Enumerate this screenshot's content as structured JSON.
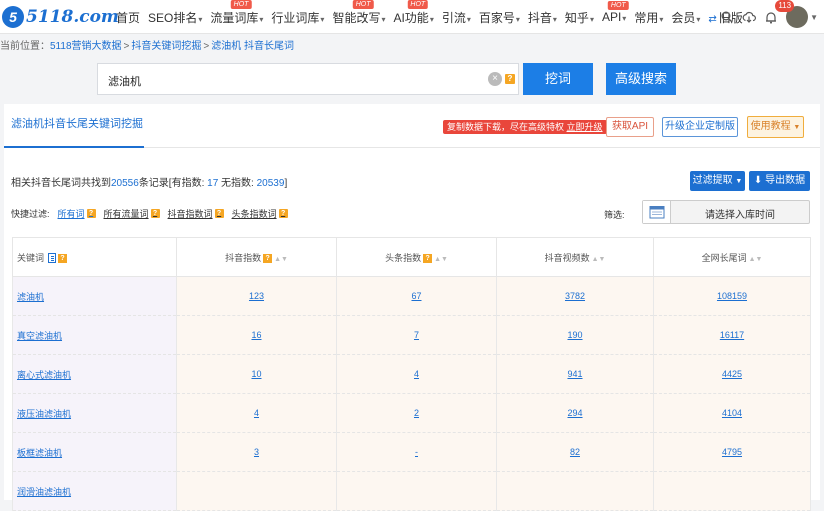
{
  "brand": {
    "logo_mark": "5",
    "logo_text": "5118.com"
  },
  "nav": [
    {
      "label": "首页",
      "caret": false,
      "hot": false
    },
    {
      "label": "SEO排名",
      "caret": true,
      "hot": false
    },
    {
      "label": "流量词库",
      "caret": true,
      "hot": true
    },
    {
      "label": "行业词库",
      "caret": true,
      "hot": false
    },
    {
      "label": "智能改写",
      "caret": true,
      "hot": true
    },
    {
      "label": "AI功能",
      "caret": true,
      "hot": true
    },
    {
      "label": "引流",
      "caret": true,
      "hot": false
    },
    {
      "label": "百家号",
      "caret": true,
      "hot": false
    },
    {
      "label": "抖音",
      "caret": true,
      "hot": false
    },
    {
      "label": "知乎",
      "caret": true,
      "hot": false
    },
    {
      "label": "API",
      "caret": true,
      "hot": true
    },
    {
      "label": "常用",
      "caret": true,
      "hot": false
    },
    {
      "label": "会员",
      "caret": true,
      "hot": false
    },
    {
      "label": "旧版",
      "caret": false,
      "hot": false
    }
  ],
  "hot_label": "HOT",
  "notifications_badge": "113",
  "breadcrumb": {
    "prefix": "当前位置：",
    "items": [
      "5118营销大数据",
      "抖音关键词挖掘",
      "滤油机 抖音长尾词"
    ]
  },
  "search": {
    "value": "滤油机",
    "dig_label": "挖词",
    "advanced_label": "高级搜索"
  },
  "card": {
    "title": "滤油机抖音长尾关键词挖掘",
    "promo": {
      "text": "复制数据下载，尽在高级特权 ",
      "link": "立即升级"
    },
    "api_label": "获取API",
    "enterprise_label": "升级企业定制版",
    "tutorial_label": "使用教程"
  },
  "summary": {
    "prefix": "相关抖音长尾词共找到",
    "total": "20556",
    "mid": "条记录[有指数:",
    "with_index": "17",
    "mid2": " 无指数:",
    "without_index": "20539",
    "suffix": "]"
  },
  "actions": {
    "filter_label": "过滤提取",
    "export_label": "导出数据"
  },
  "quick_filter": {
    "label": "快捷过滤:",
    "items": [
      "所有词",
      "所有流量词",
      "抖音指数词",
      "头条指数词"
    ]
  },
  "date_filter": {
    "label": "筛选:",
    "placeholder": "请选择入库时间"
  },
  "table": {
    "headers": [
      "关键词",
      "抖音指数",
      "头条指数",
      "抖音视频数",
      "全网长尾词"
    ],
    "rows": [
      [
        "滤油机",
        "123",
        "67",
        "3782",
        "108159"
      ],
      [
        "真空滤油机",
        "16",
        "7",
        "190",
        "16117"
      ],
      [
        "离心式滤油机",
        "10",
        "4",
        "941",
        "4425"
      ],
      [
        "液压油滤油机",
        "4",
        "2",
        "294",
        "4104"
      ],
      [
        "板框滤油机",
        "3",
        "-",
        "82",
        "4795"
      ],
      [
        "润滑油滤油机",
        "",
        "",
        "",
        ""
      ]
    ]
  },
  "colors": {
    "brand_blue": "#1c6fd1",
    "button_blue": "#1c7ee6",
    "hot_red": "#f05a4a",
    "help_orange": "#f5a623"
  }
}
